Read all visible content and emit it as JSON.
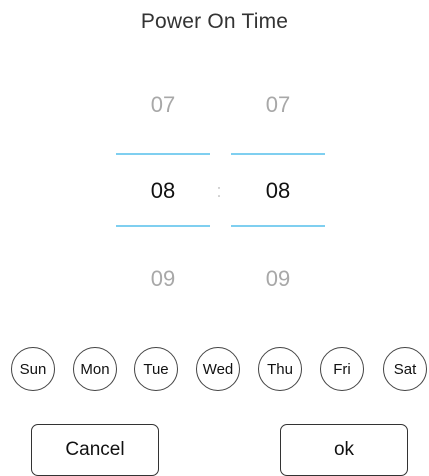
{
  "dialog": {
    "title": "Power On Time"
  },
  "picker": {
    "hour": {
      "previous": "07",
      "selected": "08",
      "next": "09"
    },
    "minute": {
      "previous": "07",
      "selected": "08",
      "next": "09"
    },
    "separator": ":",
    "accent_color": "#7fcff0"
  },
  "days": [
    {
      "label": "Sun"
    },
    {
      "label": "Mon"
    },
    {
      "label": "Tue"
    },
    {
      "label": "Wed"
    },
    {
      "label": "Thu"
    },
    {
      "label": "Fri"
    },
    {
      "label": "Sat"
    }
  ],
  "buttons": {
    "cancel_label": "Cancel",
    "ok_label": "ok"
  }
}
